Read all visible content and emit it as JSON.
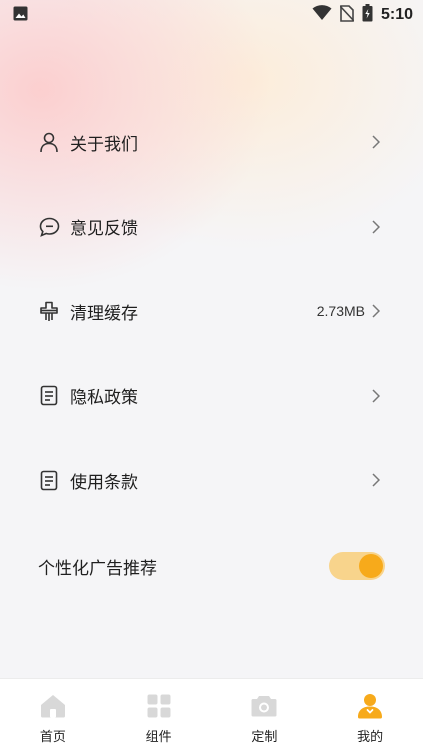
{
  "status_bar": {
    "time": "5:10",
    "icons": [
      "image-icon",
      "wifi-icon",
      "no-sim-icon",
      "battery-icon"
    ]
  },
  "menu": {
    "items": [
      {
        "label": "关于我们",
        "icon": "person-icon",
        "value": ""
      },
      {
        "label": "意见反馈",
        "icon": "chat-bubble-icon",
        "value": ""
      },
      {
        "label": "清理缓存",
        "icon": "brush-icon",
        "value": "2.73MB"
      },
      {
        "label": "隐私政策",
        "icon": "document-icon",
        "value": ""
      },
      {
        "label": "使用条款",
        "icon": "document-icon",
        "value": ""
      }
    ]
  },
  "ad_setting": {
    "label": "个性化广告推荐",
    "enabled": true
  },
  "tabbar": {
    "tabs": [
      {
        "label": "首页",
        "icon": "home-icon",
        "active": false
      },
      {
        "label": "组件",
        "icon": "grid-icon",
        "active": false
      },
      {
        "label": "定制",
        "icon": "camera-icon",
        "active": false
      },
      {
        "label": "我的",
        "icon": "profile-icon",
        "active": true
      }
    ]
  },
  "colors": {
    "accent": "#f7aa1b",
    "accent_light": "#f8d48c",
    "tab_inactive": "#d8d8d8",
    "text": "#1f1f1f"
  }
}
